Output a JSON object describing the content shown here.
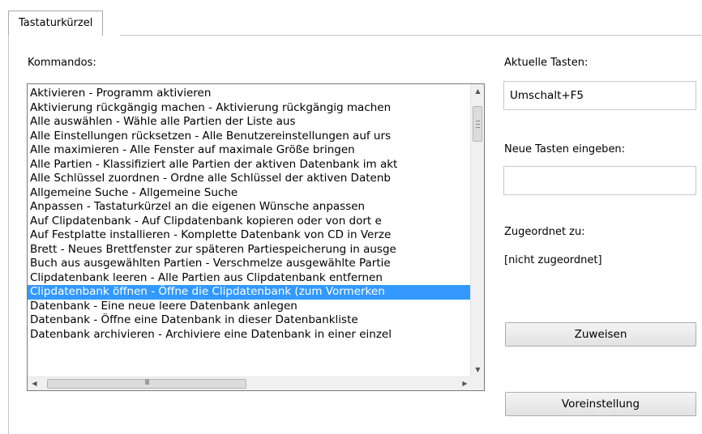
{
  "tab": {
    "label": "Tastaturkürzel"
  },
  "commands": {
    "label": "Kommandos:",
    "items": [
      "Aktivieren - Programm aktivieren",
      "Aktivierung rückgängig machen - Aktivierung rückgängig machen",
      "Alle auswählen - Wähle alle Partien der Liste aus",
      "Alle Einstellungen rücksetzen - Alle Benutzereinstellungen auf urs",
      "Alle maximieren - Alle Fenster auf maximale Größe bringen",
      "Alle Partien - Klassifiziert alle Partien der aktiven Datenbank im akt",
      "Alle Schlüssel zuordnen - Ordne alle Schlüssel der aktiven Datenb",
      "Allgemeine Suche - Allgemeine Suche",
      "Anpassen - Tastaturkürzel an die eigenen Wünsche anpassen",
      "Auf Clipdatenbank - Auf Clipdatenbank kopieren oder von dort e",
      "Auf Festplatte installieren - Komplette Datenbank von CD in Verze",
      "Brett - Neues Brettfenster zur späteren Partiespeicherung in ausge",
      "Buch aus ausgewählten Partien - Verschmelze ausgewählte Partie",
      "Clipdatenbank leeren - Alle Partien aus Clipdatenbank entfernen",
      "Clipdatenbank öffnen - Öffne die Clipdatenbank (zum Vormerken",
      "Datenbank - Eine neue leere Datenbank anlegen",
      "Datenbank - Öffne eine Datenbank in dieser Datenbankliste",
      "Datenbank archivieren - Archiviere eine Datenbank in einer einzel"
    ],
    "selected_index": 14,
    "hscroll_thumb_glyph": "III",
    "arrow_up": "▲",
    "arrow_down": "▼",
    "arrow_left": "◀",
    "arrow_right": "▶"
  },
  "current_keys": {
    "label": "Aktuelle Tasten:",
    "value": "Umschalt+F5"
  },
  "new_keys": {
    "label": "Neue Tasten eingeben:",
    "value": ""
  },
  "assigned_to": {
    "label": "Zugeordnet zu:",
    "value": "[nicht zugeordnet]"
  },
  "buttons": {
    "assign": "Zuweisen",
    "default": "Voreinstellung"
  },
  "colors": {
    "selection": "#3399ff",
    "border": "#c8c8c8"
  }
}
